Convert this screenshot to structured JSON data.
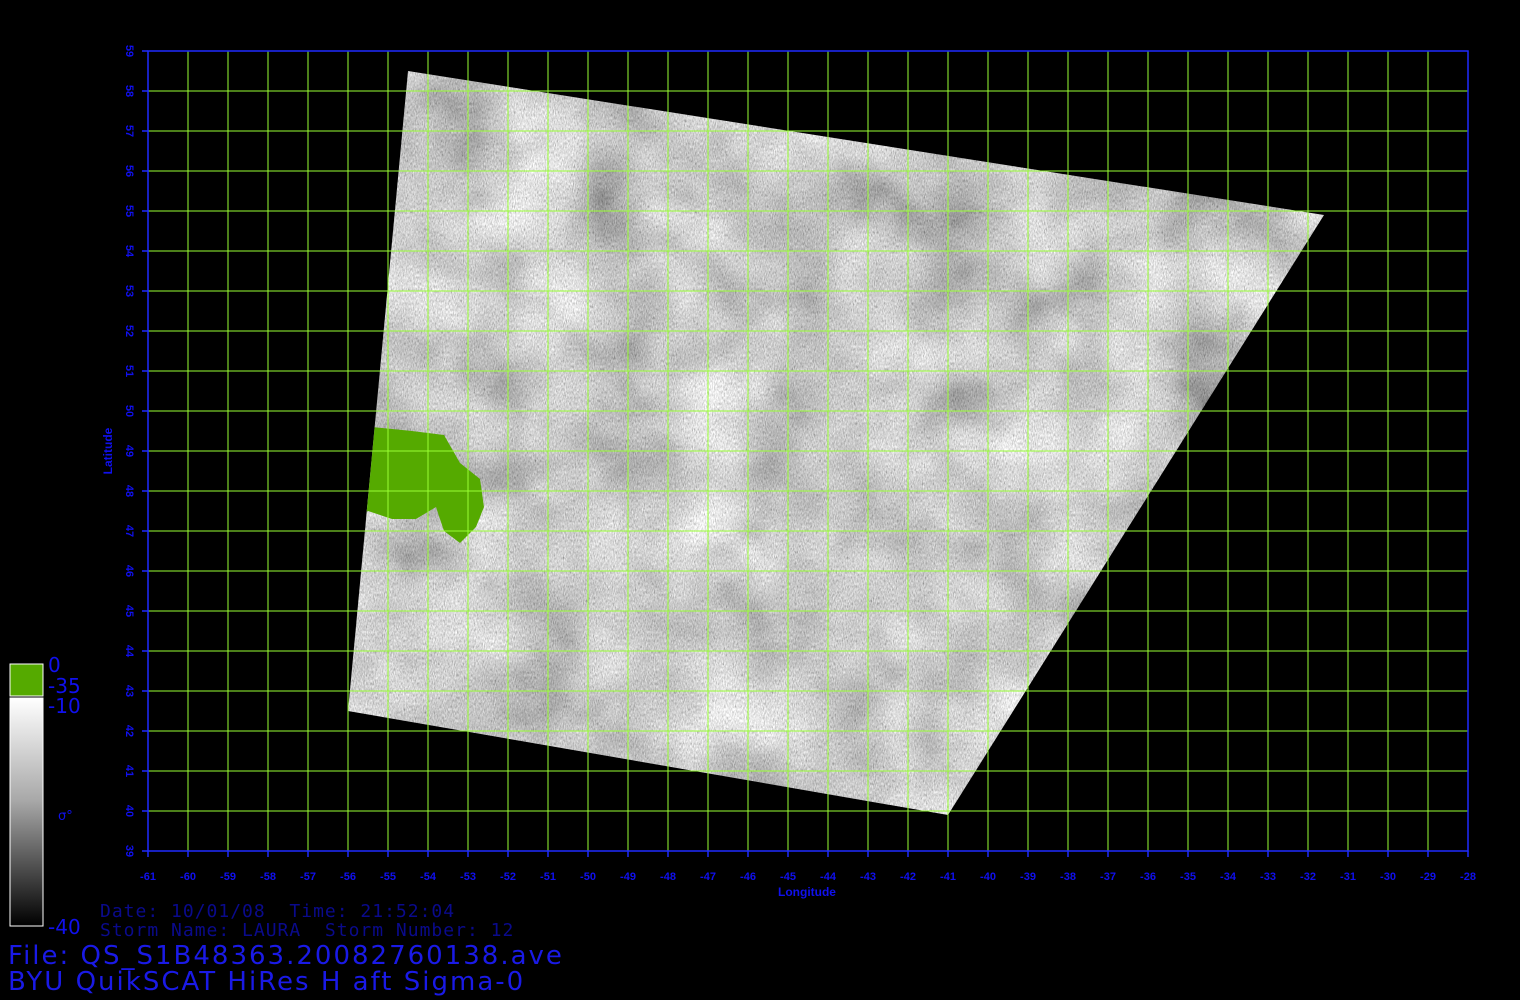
{
  "map": {
    "lon_min": -61,
    "lon_max": -28,
    "lat_min": 39,
    "lat_max": 59,
    "x_axis_label": "Longitude",
    "y_axis_label": "Latitude",
    "x_ticks": [
      "-61",
      "-60",
      "-59",
      "-58",
      "-57",
      "-56",
      "-55",
      "-54",
      "-53",
      "-52",
      "-51",
      "-50",
      "-49",
      "-48",
      "-47",
      "-46",
      "-45",
      "-44",
      "-43",
      "-42",
      "-41",
      "-40",
      "-39",
      "-38",
      "-37",
      "-36",
      "-35",
      "-34",
      "-33",
      "-32",
      "-31",
      "-30",
      "-29",
      "-28"
    ],
    "y_ticks": [
      "39",
      "40",
      "41",
      "42",
      "43",
      "44",
      "45",
      "46",
      "47",
      "48",
      "49",
      "50",
      "51",
      "52",
      "53",
      "54",
      "55",
      "56",
      "57",
      "58",
      "59"
    ],
    "swath_corners_lonlat": [
      [
        -54.5,
        58.5
      ],
      [
        -31.6,
        54.9
      ],
      [
        -41.0,
        39.9
      ],
      [
        -56.0,
        42.5
      ]
    ],
    "grid_color": "#99ff33",
    "frame_color": "#1f2bff",
    "land_color": "#55aa00",
    "land_label": "Newfoundland (land mask)"
  },
  "legend": {
    "land_top_label": "0",
    "land_bottom_label": "-35",
    "ocean_top_label": "-10",
    "ocean_bottom_label": "-40",
    "quantity_label": "σ°",
    "land_color": "#55aa00"
  },
  "info": {
    "date_line": "Date: 10/01/08  Time: 21:52:04",
    "storm_line": "Storm Name: LAURA  Storm Number: 12",
    "file_line": "File: QS_S1B48363.20082760138.ave",
    "product_line": "BYU QuikSCAT HiRes H aft Sigma-0"
  }
}
